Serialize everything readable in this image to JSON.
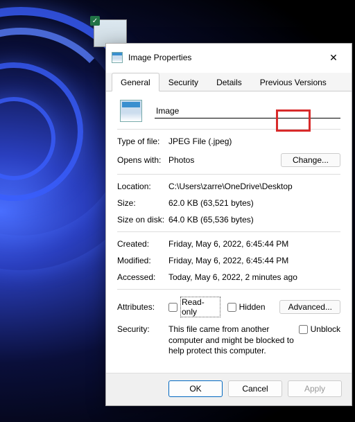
{
  "dialog": {
    "title": "Image Properties",
    "tabs": {
      "general": "General",
      "security": "Security",
      "details": "Details",
      "previous": "Previous Versions"
    },
    "file_name": "Image",
    "fields": {
      "type_label": "Type of file:",
      "type_value": "JPEG File (.jpeg)",
      "opens_label": "Opens with:",
      "opens_value": "Photos",
      "change_btn": "Change...",
      "location_label": "Location:",
      "location_value": "C:\\Users\\zarre\\OneDrive\\Desktop",
      "size_label": "Size:",
      "size_value": "62.0 KB (63,521 bytes)",
      "disk_label": "Size on disk:",
      "disk_value": "64.0 KB (65,536 bytes)",
      "created_label": "Created:",
      "created_value": "Friday, May 6, 2022, 6:45:44 PM",
      "modified_label": "Modified:",
      "modified_value": "Friday, May 6, 2022, 6:45:44 PM",
      "accessed_label": "Accessed:",
      "accessed_value": "Today, May 6, 2022, 2 minutes ago",
      "attributes_label": "Attributes:",
      "readonly_label": "Read-only",
      "hidden_label": "Hidden",
      "advanced_btn": "Advanced...",
      "security_label": "Security:",
      "security_text": "This file came from another computer and might be blocked to help protect this computer.",
      "unblock_label": "Unblock"
    },
    "buttons": {
      "ok": "OK",
      "cancel": "Cancel",
      "apply": "Apply"
    }
  }
}
